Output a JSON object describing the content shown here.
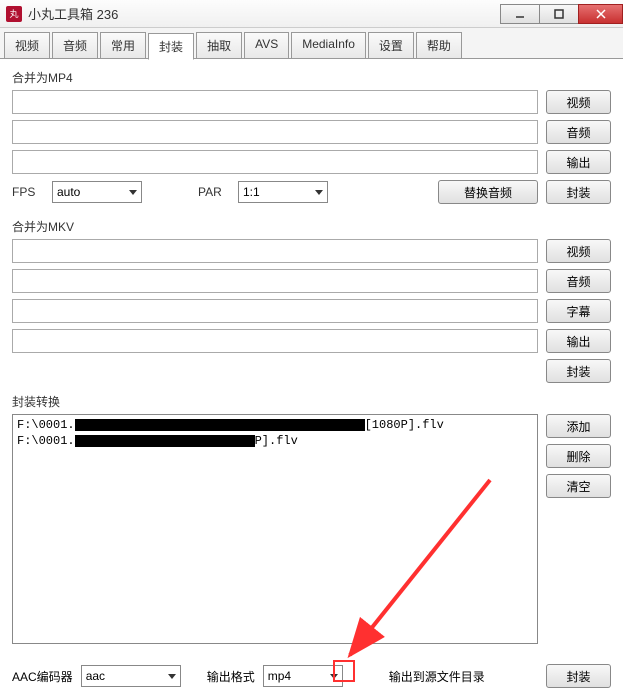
{
  "window": {
    "title": "小丸工具箱 236",
    "icon_text": "丸"
  },
  "tabs": [
    "视频",
    "音频",
    "常用",
    "封装",
    "抽取",
    "AVS",
    "MediaInfo",
    "设置",
    "帮助"
  ],
  "active_tab_index": 3,
  "mp4": {
    "title": "合并为MP4",
    "btn_video": "视频",
    "btn_audio": "音频",
    "btn_output": "输出",
    "fps_label": "FPS",
    "fps_value": "auto",
    "par_label": "PAR",
    "par_value": "1:1",
    "btn_replace": "替换音频",
    "btn_mux": "封装"
  },
  "mkv": {
    "title": "合并为MKV",
    "btn_video": "视频",
    "btn_audio": "音频",
    "btn_sub": "字幕",
    "btn_output": "输出",
    "btn_mux": "封装"
  },
  "convert": {
    "title": "封装转换",
    "items": [
      {
        "prefix": "F:\\0001.",
        "suffix": "[1080P].flv",
        "blackw": 290
      },
      {
        "prefix": "F:\\0001.",
        "suffix": "P].flv",
        "blackw": 180
      }
    ],
    "btn_add": "添加",
    "btn_del": "删除",
    "btn_clear": "清空"
  },
  "bottom": {
    "encoder_label": "AAC编码器",
    "encoder_value": "aac",
    "format_label": "输出格式",
    "format_value": "mp4",
    "outdir_label": "输出到源文件目录",
    "btn_mux": "封装"
  }
}
